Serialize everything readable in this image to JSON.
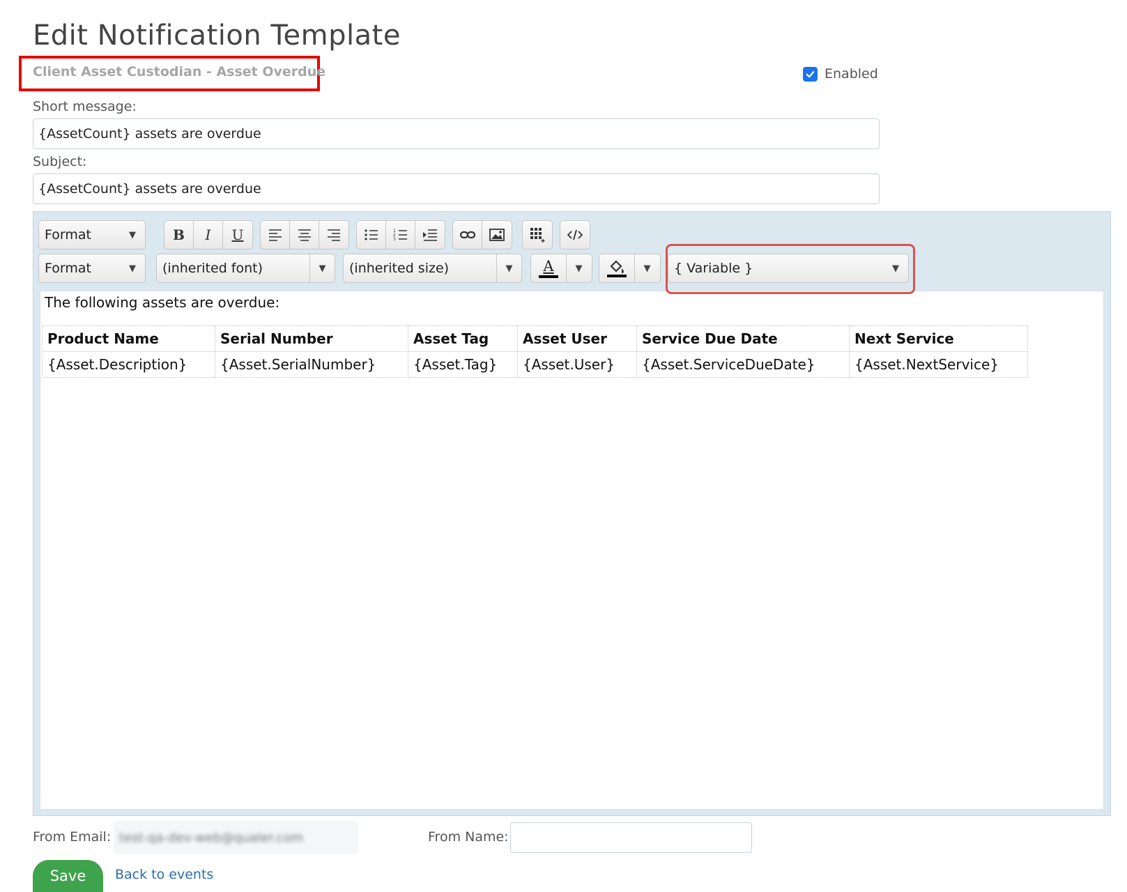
{
  "page": {
    "title": "Edit Notification Template",
    "subtitle": "Client Asset Custodian - Asset Overdue",
    "enabled_label": "Enabled",
    "enabled": true
  },
  "fields": {
    "short_message_label": "Short message:",
    "short_message_value": "{AssetCount} assets are overdue",
    "subject_label": "Subject:",
    "subject_value": "{AssetCount} assets are overdue"
  },
  "toolbar": {
    "format1": "Format",
    "format2": "Format",
    "font": "(inherited font)",
    "size": "(inherited size)",
    "variable": "{ Variable }",
    "bold": "B",
    "italic": "I",
    "underline": "U",
    "text_color_glyph": "A"
  },
  "content": {
    "intro": "The following assets are overdue:",
    "table": {
      "headers": [
        "Product Name",
        "Serial Number",
        "Asset Tag",
        "Asset User",
        "Service Due Date",
        "Next Service"
      ],
      "rows": [
        [
          "{Asset.Description}",
          "{Asset.SerialNumber}",
          "{Asset.Tag}",
          "{Asset.User}",
          "{Asset.ServiceDueDate}",
          "{Asset.NextService}"
        ]
      ]
    }
  },
  "footer": {
    "from_email_label": "From Email:",
    "from_email_value": "test-qa-dev-web@qualer.com",
    "from_name_label": "From Name:",
    "from_name_value": "",
    "save_label": "Save",
    "back_label": "Back to events"
  },
  "colors": {
    "highlight_red": "#e60000",
    "variable_border": "#d9534f",
    "save_green": "#3fa34d",
    "link_blue": "#2b6cb0",
    "checkbox_blue": "#1a73e8"
  }
}
